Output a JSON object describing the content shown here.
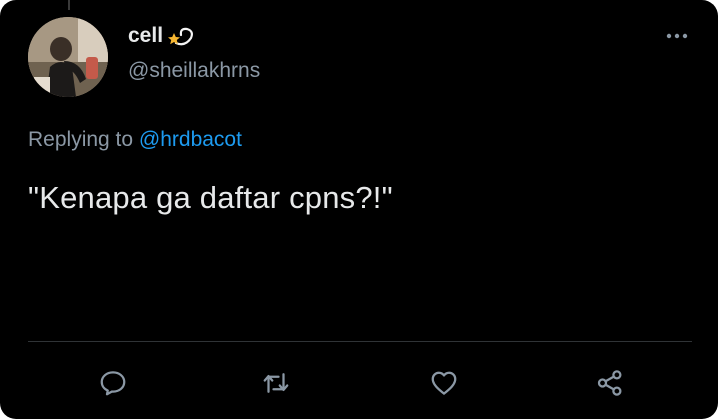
{
  "tweet": {
    "display_name": "cell",
    "name_emoji": "dizzy-star-emoji",
    "handle": "@sheillakhrns",
    "replying_prefix": "Replying to",
    "replying_to": "@hrdbacot",
    "text": "\"Kenapa ga daftar cpns?!\""
  },
  "actions": {
    "reply_icon": "reply-icon",
    "retweet_icon": "retweet-icon",
    "like_icon": "heart-icon",
    "share_icon": "share-icon"
  },
  "colors": {
    "background": "#000000",
    "primary_text": "#e7e9ea",
    "secondary_text": "#8b98a5",
    "mention": "#1d9bf0",
    "divider": "#2f3336"
  }
}
